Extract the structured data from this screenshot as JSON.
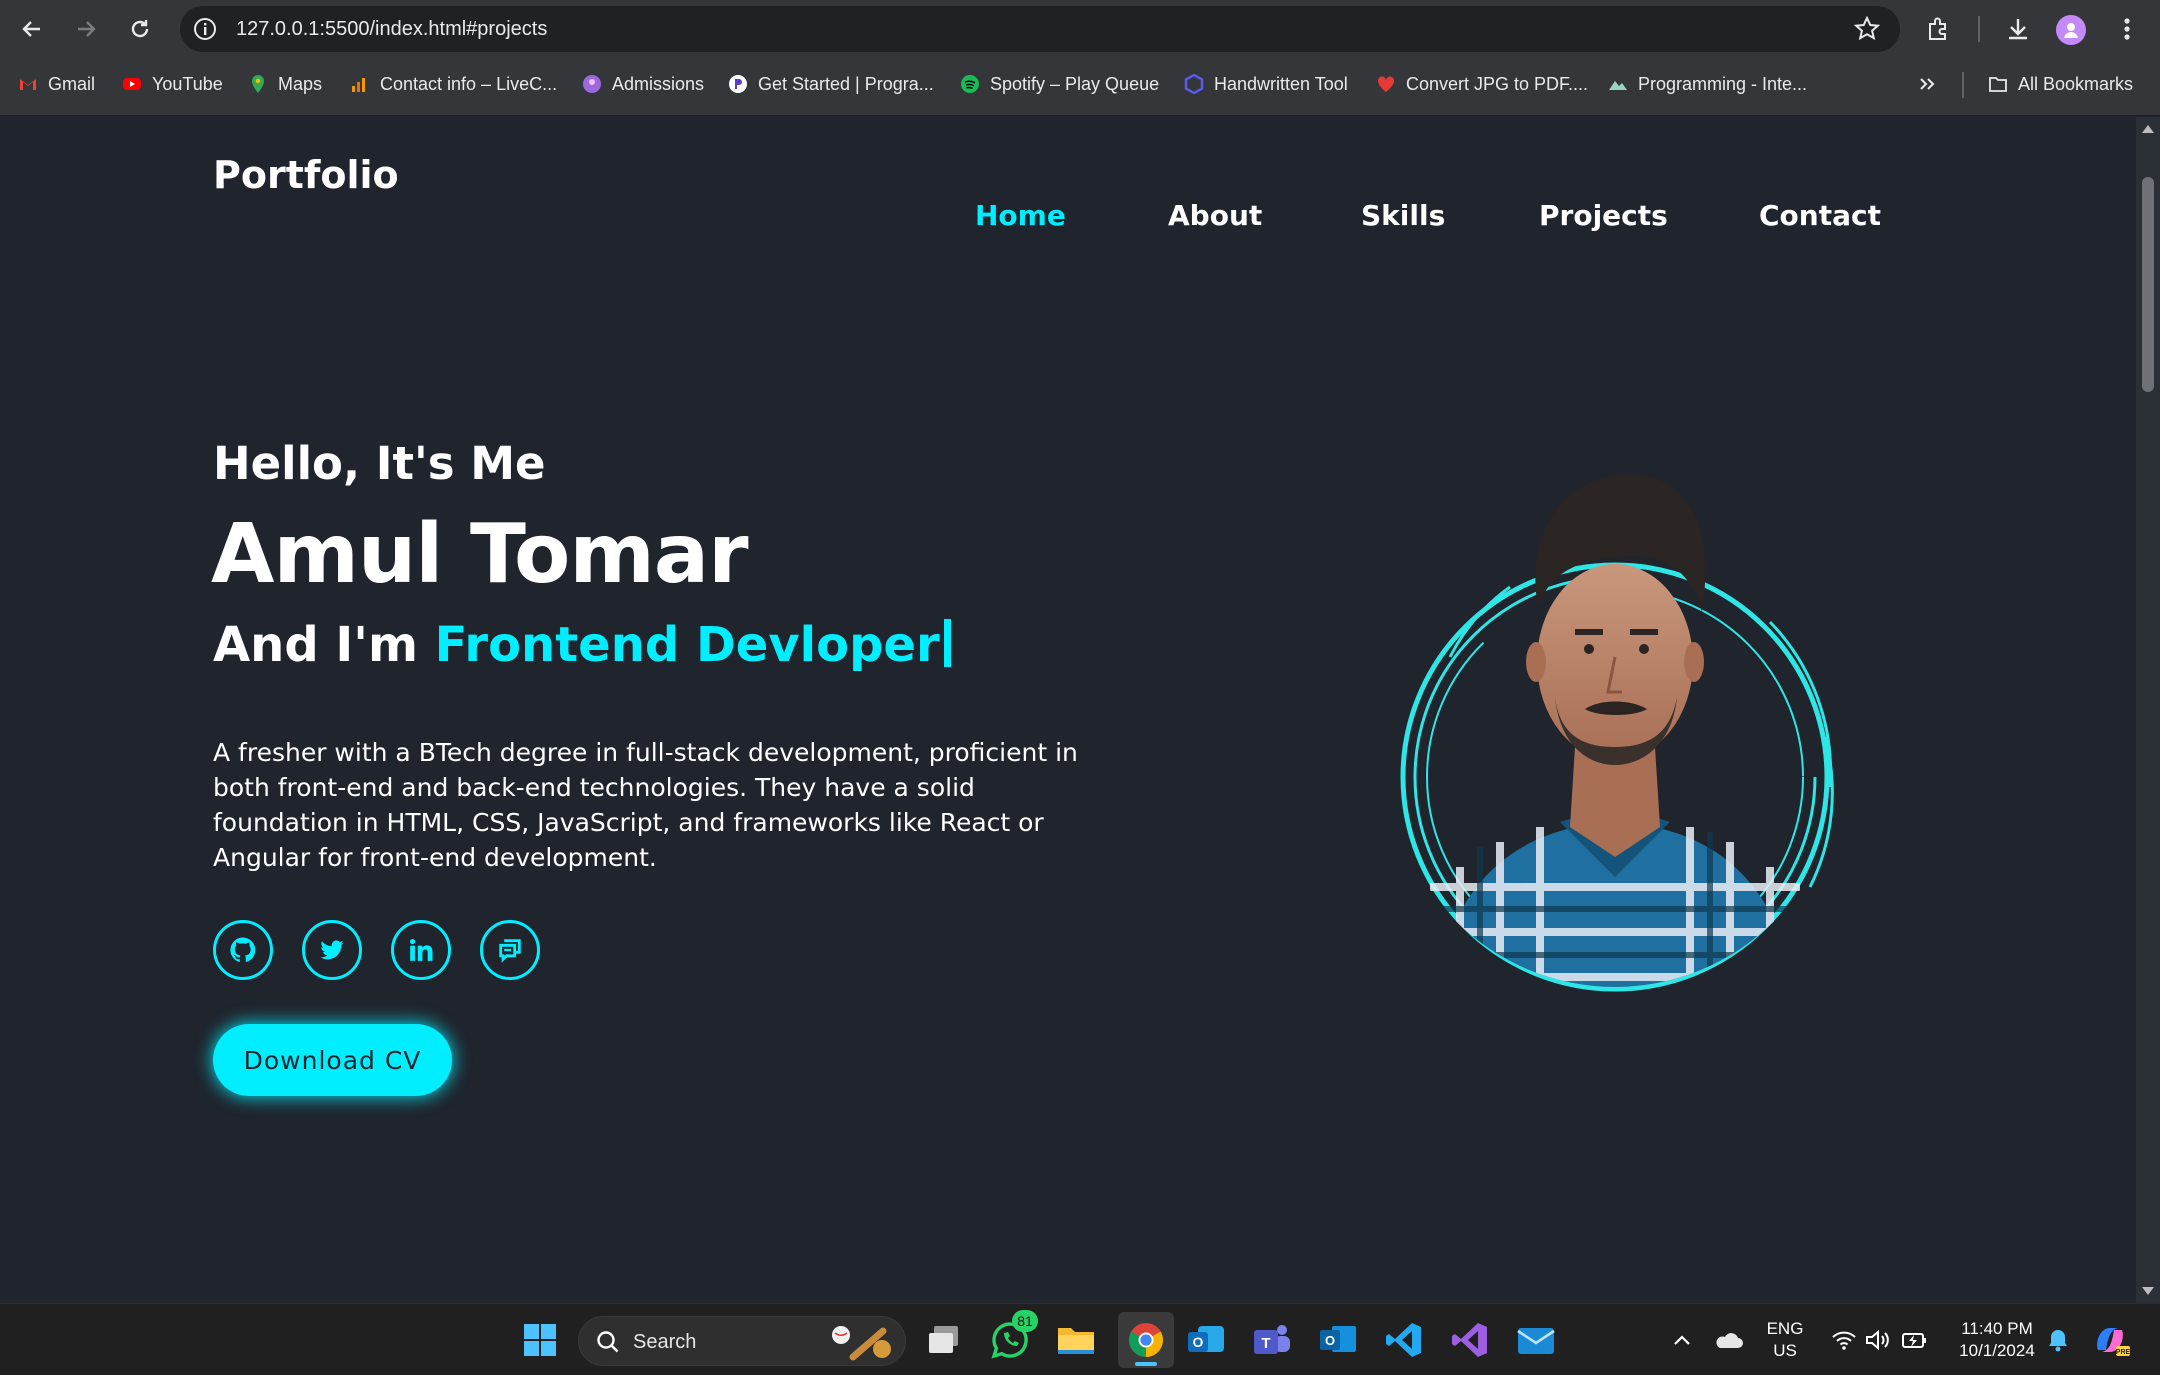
{
  "browser": {
    "url": "127.0.0.1:5500/index.html#projects",
    "bookmarks": [
      {
        "label": "Gmail",
        "icon": "gmail-icon",
        "color": "#ea4335"
      },
      {
        "label": "YouTube",
        "icon": "youtube-icon",
        "color": "#ff0000"
      },
      {
        "label": "Maps",
        "icon": "maps-icon",
        "color": "#34a853"
      },
      {
        "label": "Contact info – LiveC...",
        "icon": "livec-icon",
        "color": "#f29900"
      },
      {
        "label": "Admissions",
        "icon": "admissions-icon",
        "color": "#9c6ade"
      },
      {
        "label": "Get Started | Progra...",
        "icon": "program-icon",
        "color": "#ffffff"
      },
      {
        "label": "Spotify – Play Queue",
        "icon": "spotify-icon",
        "color": "#1db954"
      },
      {
        "label": "Handwritten Tool",
        "icon": "handwritten-icon",
        "color": "#5b5bf5"
      },
      {
        "label": "Convert JPG to PDF....",
        "icon": "pdf-heart-icon",
        "color": "#e53935"
      },
      {
        "label": "Programming - Inte...",
        "icon": "programming-icon",
        "color": "#9ad3c6"
      }
    ],
    "all_bookmarks": "All Bookmarks"
  },
  "site": {
    "logo": "Portfolio",
    "nav": [
      "Home",
      "About",
      "Skills",
      "Projects",
      "Contact"
    ],
    "active_nav": "Home",
    "hero": {
      "greeting": "Hello, It's Me",
      "name": "Amul Tomar",
      "role_prefix": "And I'm ",
      "role_highlight": "Frontend Devloper",
      "description": "A fresher with a BTech degree in full-stack development, proficient in both front-end and back-end technologies. They have a solid foundation in HTML, CSS, JavaScript, and frameworks like React or Angular for front-end development.",
      "socials": [
        "github-icon",
        "twitter-icon",
        "linkedin-icon",
        "chat-icon"
      ],
      "cta": "Download CV"
    },
    "accent": "#00eeff",
    "background": "#1f242d"
  },
  "taskbar": {
    "search": "Search",
    "whatsapp_badge": "81",
    "lang_top": "ENG",
    "lang_bottom": "US",
    "time": "11:40 PM",
    "date": "10/1/2024"
  }
}
